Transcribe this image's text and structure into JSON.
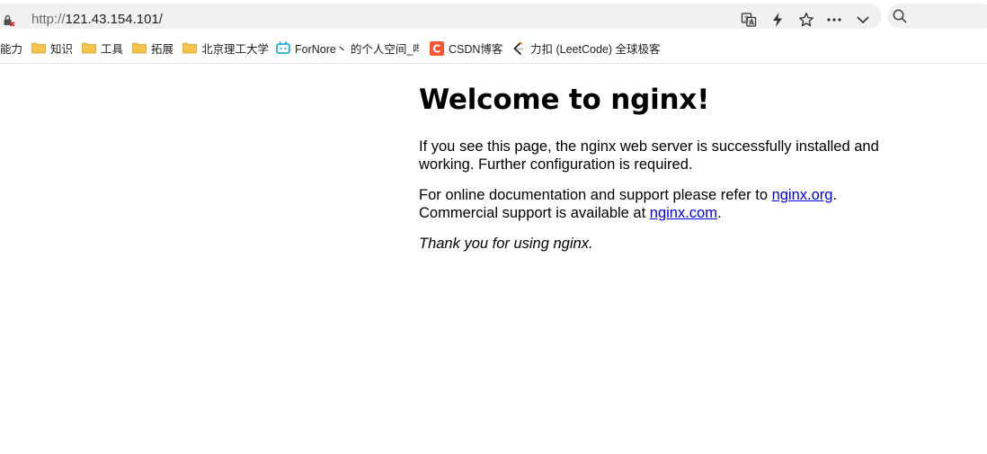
{
  "browser": {
    "url_scheme": "http://",
    "url_host": "121.43.154.101/",
    "icons": [
      "lock-warning-icon",
      "translate-icon",
      "lightning-icon",
      "star-icon",
      "more-icon",
      "chevron-down-icon",
      "search-icon"
    ]
  },
  "bookmarks": [
    {
      "label": "能力",
      "icon": "none"
    },
    {
      "label": "知识",
      "icon": "folder-icon"
    },
    {
      "label": "工具",
      "icon": "folder-icon"
    },
    {
      "label": "拓展",
      "icon": "folder-icon"
    },
    {
      "label": "北京理工大学",
      "icon": "folder-icon"
    },
    {
      "label": "ForNore丶 的个人空间_哔",
      "icon": "bilibili-icon"
    },
    {
      "label": "CSDN博客",
      "icon": "csdn-icon"
    },
    {
      "label": "力扣 (LeetCode) 全球极客",
      "icon": "leetcode-icon"
    }
  ],
  "page": {
    "heading": "Welcome to nginx!",
    "para1": "If you see this page, the nginx web server is successfully installed and working. Further configuration is required.",
    "para2_a": "For online documentation and support please refer to ",
    "link1": "nginx.org",
    "para2_b": ".",
    "para2_c": "Commercial support is available at ",
    "link2": "nginx.com",
    "para2_d": ".",
    "para3": "Thank you for using nginx."
  },
  "colors": {
    "link": "#0000ee",
    "folder": "#f5c24a",
    "csdn": "#fc5531",
    "bilibili": "#00a1d6"
  }
}
